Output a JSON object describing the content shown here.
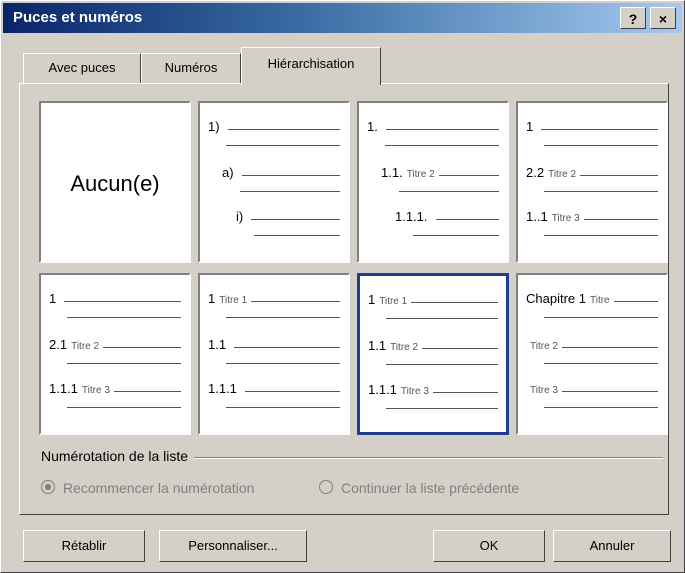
{
  "window": {
    "title": "Puces et numéros",
    "help_glyph": "?",
    "close_glyph": "×"
  },
  "tabs": [
    {
      "label": "Avec puces",
      "active": false
    },
    {
      "label": "Numéros",
      "active": false
    },
    {
      "label": "Hiérarchisation",
      "active": true
    }
  ],
  "gallery": [
    {
      "kind": "none",
      "label": "Aucun(e)",
      "selected": false
    },
    {
      "kind": "list",
      "selected": false,
      "rows": [
        {
          "num": "1)",
          "title": ""
        },
        {
          "num": "a)",
          "title": ""
        },
        {
          "num": "i)",
          "title": ""
        }
      ]
    },
    {
      "kind": "list",
      "selected": false,
      "rows": [
        {
          "num": "1.",
          "title": ""
        },
        {
          "num": "1.1.",
          "title": "Titre 2"
        },
        {
          "num": "1.1.1.",
          "title": ""
        }
      ]
    },
    {
      "kind": "list",
      "selected": false,
      "rows": [
        {
          "num": "1",
          "title": ""
        },
        {
          "num": "2.2",
          "title": "Titre 2"
        },
        {
          "num": "1..1",
          "title": "Titre 3"
        }
      ]
    },
    {
      "kind": "list",
      "selected": false,
      "rows": [
        {
          "num": "1",
          "title": ""
        },
        {
          "num": "2.1",
          "title": "Titre 2"
        },
        {
          "num": "1.1.1",
          "title": "Titre 3"
        }
      ]
    },
    {
      "kind": "list",
      "selected": false,
      "rows": [
        {
          "num": "1",
          "title": "Titre 1"
        },
        {
          "num": "1.1",
          "title": ""
        },
        {
          "num": "1.1.1",
          "title": ""
        }
      ]
    },
    {
      "kind": "list",
      "selected": true,
      "rows": [
        {
          "num": "1",
          "title": "Titre 1"
        },
        {
          "num": "1.1",
          "title": "Titre 2"
        },
        {
          "num": "1.1.1",
          "title": "Titre 3"
        }
      ]
    },
    {
      "kind": "list",
      "selected": false,
      "rows": [
        {
          "num": "Chapitre 1",
          "title": "Titre"
        },
        {
          "num": "",
          "title": "Titre 2"
        },
        {
          "num": "",
          "title": "Titre 3"
        }
      ]
    }
  ],
  "numbering": {
    "section_label": "Numérotation de la liste",
    "restart_label": "Recommencer la numérotation",
    "continue_label": "Continuer la liste précédente",
    "restart_checked": true,
    "enabled": false
  },
  "buttons": {
    "reset": "Rétablir",
    "customize": "Personnaliser...",
    "ok": "OK",
    "cancel": "Annuler"
  },
  "icons": [
    "help-icon",
    "close-icon",
    "radio-icon"
  ]
}
